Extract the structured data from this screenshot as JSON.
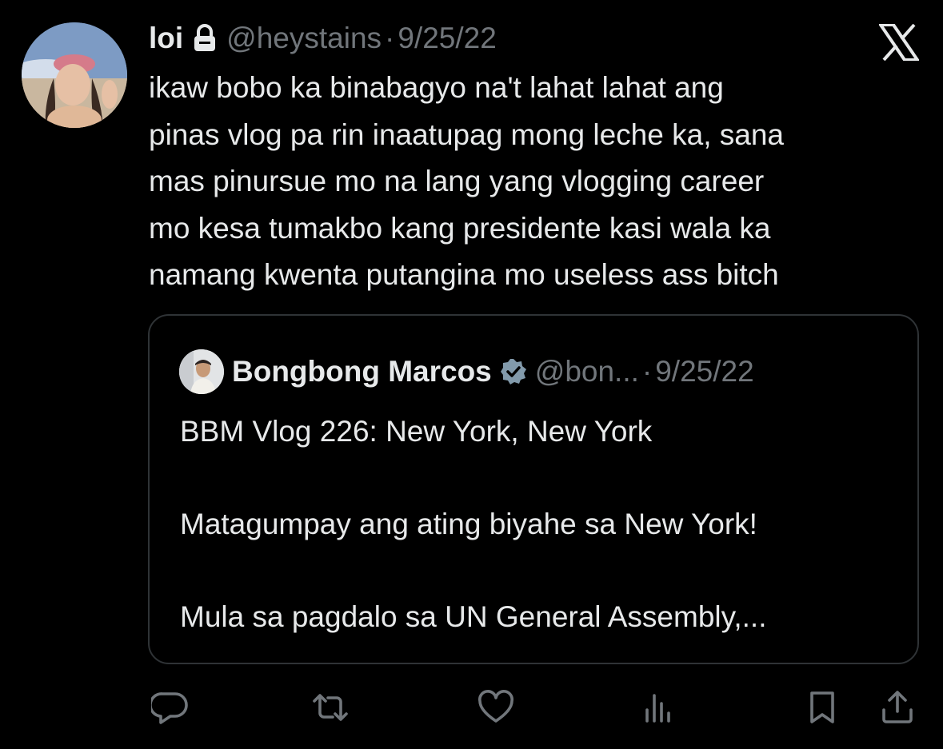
{
  "tweet": {
    "author": {
      "name": "loi",
      "handle": "@heystains",
      "protected": true,
      "avatar_icon": "user-avatar-photo"
    },
    "separator": "·",
    "date": "9/25/22",
    "text": "ikaw bobo ka binabagyo na't lahat lahat ang pinas vlog pa rin inaatupag mong leche ka, sana mas pinursue mo na lang yang vlogging career mo kesa tumakbo kang presidente kasi wala ka namang kwenta putangina mo useless ass bitch",
    "text_lines": [
      "ikaw bobo ka binabagyo na't lahat lahat ang",
      "pinas vlog pa rin inaatupag mong leche ka, sana",
      "mas pinursue mo na lang yang vlogging career",
      "mo kesa tumakbo kang presidente kasi wala ka",
      "namang kwenta putangina mo useless ass bitch"
    ]
  },
  "quote": {
    "author": {
      "name": "Bongbong Marcos",
      "handle": "@bon...",
      "verified": true,
      "avatar_icon": "user-avatar-photo"
    },
    "separator": "·",
    "date": "9/25/22",
    "lines": [
      "BBM Vlog 226: New York, New York",
      "",
      "Matagumpay ang ating biyahe sa New York!",
      "",
      "Mula sa pagdalo sa UN General Assembly,..."
    ]
  },
  "actions": [
    {
      "name": "reply",
      "icon": "reply-icon"
    },
    {
      "name": "retweet",
      "icon": "retweet-icon"
    },
    {
      "name": "like",
      "icon": "heart-icon"
    },
    {
      "name": "views",
      "icon": "analytics-icon"
    },
    {
      "name": "bookmark",
      "icon": "bookmark-icon"
    },
    {
      "name": "share",
      "icon": "share-icon"
    }
  ],
  "brand": {
    "logo": "x-logo-icon"
  },
  "colors": {
    "background": "#000000",
    "text_primary": "#e7e9ea",
    "text_secondary": "#71767b",
    "border": "#2f3336",
    "verified": "#829aab"
  }
}
